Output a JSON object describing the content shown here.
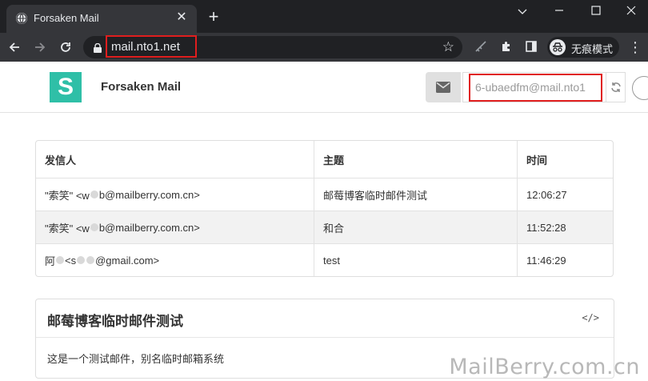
{
  "browser": {
    "tab_title": "Forsaken Mail",
    "tab_close": "✕",
    "new_tab": "+",
    "url": "mail.nto1.net",
    "incognito_label": "无痕模式"
  },
  "header": {
    "logo_letter": "S",
    "brand": "Forsaken Mail",
    "address": "6-ubaedfm@mail.nto1"
  },
  "table": {
    "columns": [
      "发信人",
      "主题",
      "时间"
    ],
    "rows": [
      {
        "from_a": "\"索笑\" <w",
        "from_b": "b@mailberry.com.cn>",
        "subject": "邮莓博客临时邮件测试",
        "time": "12:06:27"
      },
      {
        "from_a": "\"索笑\" <w",
        "from_b": "b@mailberry.com.cn>",
        "subject": "和合",
        "time": "11:52:28"
      },
      {
        "from_a": "阿",
        "from_b": "<s",
        "from_c": "@gmail.com>",
        "subject": "test",
        "time": "11:46:29"
      }
    ]
  },
  "detail": {
    "subject": "邮莓博客临时邮件测试",
    "code_icon": "</>",
    "body": "这是一个测试邮件，别名临时邮箱系统"
  },
  "watermark": "MailBerry.com.cn",
  "colors": {
    "accent": "#2fbfa7",
    "highlight": "#e01e1e",
    "chrome_dark": "#202124",
    "chrome_mid": "#35363a"
  }
}
